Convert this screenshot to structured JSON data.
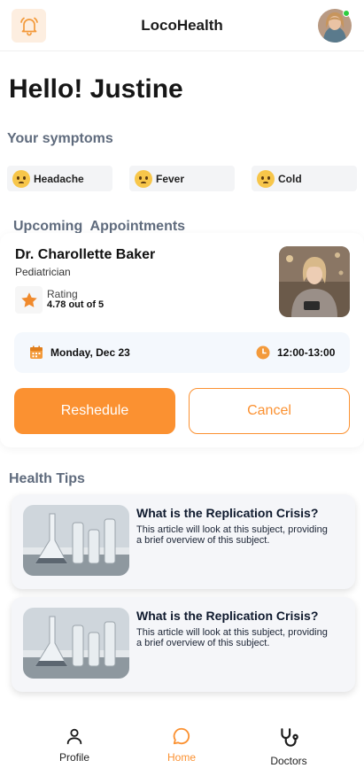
{
  "header": {
    "title": "LocoHealth",
    "bell_icon": "bell-icon",
    "avatar_icon": "user-avatar"
  },
  "greeting": "Hello! Justine",
  "symptoms": {
    "title": "Your symptoms",
    "items": [
      {
        "label": "Headache",
        "icon": "worried-face-emoji"
      },
      {
        "label": "Fever",
        "icon": "worried-face-emoji"
      },
      {
        "label": "Cold",
        "icon": "worried-face-emoji"
      }
    ]
  },
  "appointments": {
    "title": "Upcoming  Appointments",
    "doctor_name": "Dr. Charollette Baker",
    "specialty": "Pediatrician",
    "rating_label": "Rating",
    "rating_value": "4.78 out of 5",
    "date": "Monday, Dec 23",
    "time": "12:00-13:00",
    "reschedule_label": "Reshedule",
    "cancel_label": "Cancel"
  },
  "health_tips": {
    "title": "Health Tips",
    "items": [
      {
        "title": "What is the Replication Crisis?",
        "body": "This article will look at this subject, providing a brief overview of this subject."
      },
      {
        "title": "What is the Replication Crisis?",
        "body": "This article will look at this subject, providing a brief overview of this subject."
      }
    ]
  },
  "nav": {
    "items": [
      {
        "label": "Profile",
        "icon": "person-icon"
      },
      {
        "label": "Home",
        "icon": "chat-bubble-icon",
        "active": true
      },
      {
        "label": "Doctors",
        "icon": "stethoscope-icon"
      }
    ]
  },
  "colors": {
    "accent": "#fb9131",
    "section_title": "#5f6b7d",
    "chip_bg": "#f3f4f6",
    "schedule_bg": "#f4f8fd"
  }
}
